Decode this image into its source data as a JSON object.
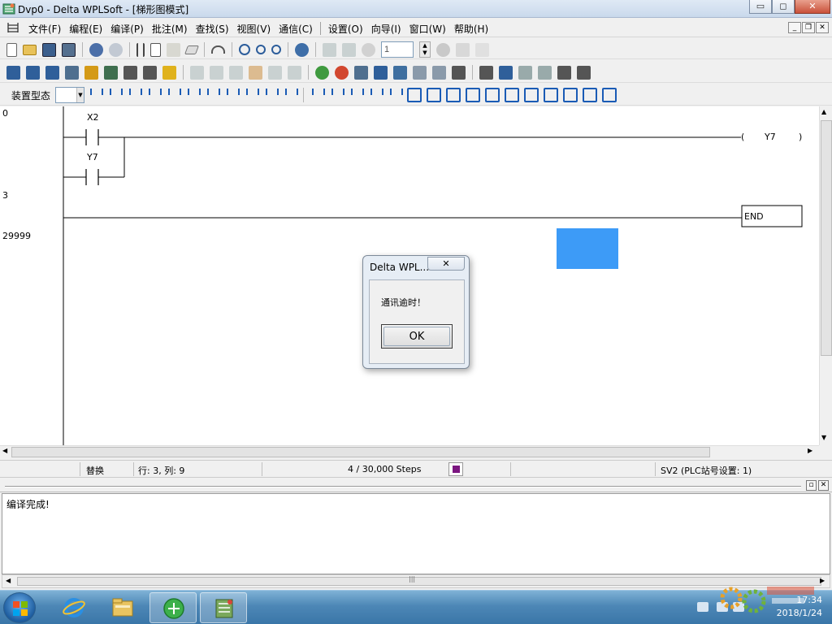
{
  "window": {
    "title": "Dvp0 - Delta WPLSoft - [梯形图模式]",
    "icon": "ladder-app-icon",
    "minimize_label": "▭",
    "maximize_label": "◻",
    "close_label": "✕"
  },
  "menu": {
    "items": [
      "文件(F)",
      "编程(E)",
      "编译(P)",
      "批注(M)",
      "查找(S)",
      "视图(V)",
      "通信(C)",
      "设置(O)",
      "向导(I)",
      "窗口(W)",
      "帮助(H)"
    ]
  },
  "toolbar1": {
    "step_value": "1"
  },
  "toolbar3": {
    "device_type_label": "装置型态",
    "device_type_value": ""
  },
  "ladder": {
    "rungs": [
      {
        "step": "0",
        "contacts": [
          "X2",
          "Y7"
        ],
        "coil": "Y7"
      },
      {
        "step": "3",
        "end": "END"
      },
      {
        "step": "29999"
      }
    ],
    "coil_open": "(",
    "coil_close": ")"
  },
  "statusbar": {
    "mode": "替换",
    "position": "行: 3, 列: 9",
    "steps": "4 / 30,000 Steps",
    "station": "SV2 (PLC站号设置: 1)",
    "indicator_color": "#7b1680"
  },
  "messages": {
    "text": "编译完成!"
  },
  "dialog": {
    "title": "Delta WPL...",
    "close_label": "✕",
    "message": "通讯逾时！",
    "ok_label": "OK"
  },
  "taskbar": {
    "apps": [
      "ie-icon",
      "explorer-icon",
      "browser-icon",
      "wplsoft-icon"
    ],
    "time": "17:34",
    "date": "2018/1/24"
  },
  "colors": {
    "highlight_blue": "#3d9bf7",
    "accent": "#1a5bb5"
  }
}
